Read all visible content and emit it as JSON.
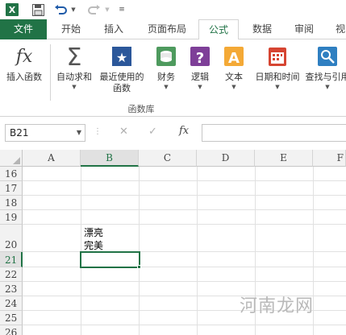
{
  "quick_access": {
    "icons": [
      "excel-logo-icon",
      "save-icon",
      "undo-icon",
      "redo-icon",
      "customize-qat-icon"
    ]
  },
  "tabs": [
    "文件",
    "开始",
    "插入",
    "页面布局",
    "公式",
    "数据",
    "审阅",
    "视"
  ],
  "active_tab": "公式",
  "ribbon": {
    "buttons": [
      {
        "label": "插入函数",
        "icon": "insert-function-icon"
      },
      {
        "label": "自动求和",
        "icon": "autosum-icon"
      },
      {
        "label": "最近使用的\n函数",
        "icon": "recently-used-icon"
      },
      {
        "label": "财务",
        "icon": "financial-icon"
      },
      {
        "label": "逻辑",
        "icon": "logical-icon"
      },
      {
        "label": "文本",
        "icon": "text-icon"
      },
      {
        "label": "日期和时间",
        "icon": "date-time-icon"
      },
      {
        "label": "查找与引用",
        "icon": "lookup-reference-icon"
      }
    ],
    "group_label": "函数库"
  },
  "formula_bar": {
    "name_box": "B21",
    "fx_label": "fx",
    "formula": ""
  },
  "grid": {
    "columns": [
      "A",
      "B",
      "C",
      "D",
      "E",
      "F"
    ],
    "selected_column": "B",
    "rows": [
      "16",
      "17",
      "18",
      "19",
      "20",
      "21",
      "22",
      "23",
      "24",
      "25",
      "26"
    ],
    "selected_row": "21",
    "cells": {
      "B20_line1": "漂亮",
      "B20_line2": "完美"
    }
  },
  "watermark": "河南龙网",
  "colors": {
    "accent": "#217346",
    "grid_line": "#e1e1e1",
    "header_bg": "#f2f2f2"
  }
}
